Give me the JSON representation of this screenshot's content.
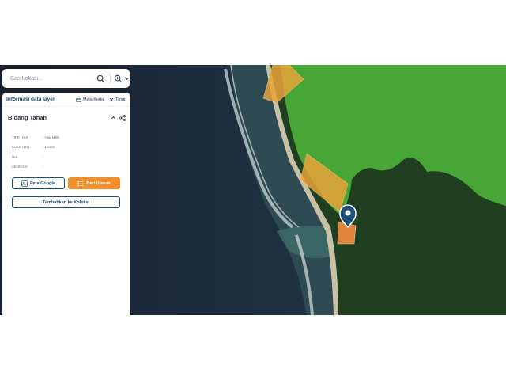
{
  "search": {
    "placeholder": "Cari Lokasi..."
  },
  "panel": {
    "title": "Informasi data layer",
    "meja_kerja": "Meja Kerja",
    "tutup": "Tutup",
    "section_title": "Bidang Tanah",
    "properties": [
      {
        "key": "TIPE HAK",
        "value": ": Hak Milik"
      },
      {
        "key": "LUAS (M2)",
        "value": ": 10000"
      },
      {
        "key": "NIB",
        "value": ":"
      },
      {
        "key": "AKURASI",
        "value": ":"
      }
    ],
    "btn_google": "Peta Google",
    "btn_ulasan": "Beri Ulasan",
    "btn_koleksi": "Tambahkan ke Koleksi"
  },
  "colors": {
    "primary": "#1d4f7a",
    "accent": "#f0902d",
    "parcel_fill": "#e8a33a",
    "forest_overlay": "#4caf3a",
    "sea": "#1d2b3c"
  },
  "icons": [
    "search-icon",
    "zoom-icon",
    "chevron-down-icon",
    "briefcase-icon",
    "close-icon",
    "chevron-up-icon",
    "share-icon",
    "map-icon",
    "list-icon",
    "location-pin-icon"
  ]
}
